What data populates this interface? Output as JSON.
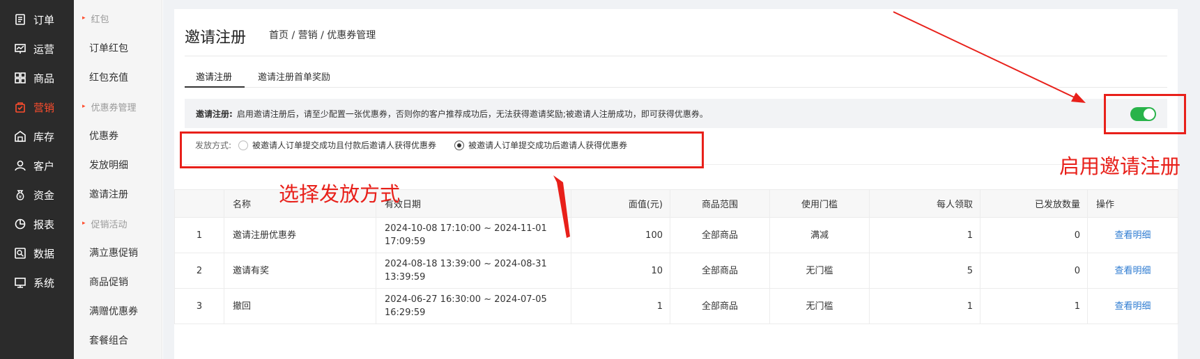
{
  "nav": [
    {
      "label": "订单",
      "icon": "order-icon"
    },
    {
      "label": "运营",
      "icon": "operation-icon"
    },
    {
      "label": "商品",
      "icon": "goods-icon"
    },
    {
      "label": "营销",
      "icon": "marketing-icon",
      "active": true
    },
    {
      "label": "库存",
      "icon": "warehouse-icon"
    },
    {
      "label": "客户",
      "icon": "user-icon"
    },
    {
      "label": "资金",
      "icon": "money-icon"
    },
    {
      "label": "报表",
      "icon": "report-icon"
    },
    {
      "label": "数据",
      "icon": "data-icon"
    },
    {
      "label": "系统",
      "icon": "monitor-icon"
    }
  ],
  "subnav": [
    {
      "label": "红包",
      "group": true
    },
    {
      "label": "订单红包"
    },
    {
      "label": "红包充值"
    },
    {
      "label": "优惠券管理",
      "group": true
    },
    {
      "label": "优惠券"
    },
    {
      "label": "发放明细"
    },
    {
      "label": "邀请注册"
    },
    {
      "label": "促销活动",
      "group": true
    },
    {
      "label": "满立惠促销"
    },
    {
      "label": "商品促销"
    },
    {
      "label": "满赠优惠券"
    },
    {
      "label": "套餐组合"
    }
  ],
  "page": {
    "title": "邀请注册",
    "breadcrumb": "首页 / 营销 / 优惠券管理"
  },
  "tabs": [
    "邀请注册",
    "邀请注册首单奖励"
  ],
  "notice": {
    "label": "邀请注册:",
    "text": "启用邀请注册后，请至少配置一张优惠券，否则你的客户推荐成功后，无法获得邀请奖励;被邀请人注册成功，即可获得优惠券。"
  },
  "toggle": {
    "on": true,
    "color": "#29b34a"
  },
  "method": {
    "label": "发放方式:",
    "options": [
      {
        "label": "被邀请人订单提交成功且付款后邀请人获得优惠券",
        "checked": false
      },
      {
        "label": "被邀请人订单提交成功后邀请人获得优惠券",
        "checked": true
      }
    ]
  },
  "table": {
    "headers": [
      "",
      "名称",
      "有效日期",
      "面值(元)",
      "商品范围",
      "使用门槛",
      "每人领取",
      "已发放数量",
      "操作"
    ],
    "rows": [
      {
        "idx": "1",
        "name": "邀请注册优惠券",
        "date1": "2024-10-08 17:10:00 ~ 2024-11-01",
        "date2": "17:09:59",
        "value": "100",
        "scope": "全部商品",
        "threshold": "满减",
        "per_person": "1",
        "issued": "0",
        "action": "查看明细"
      },
      {
        "idx": "2",
        "name": "邀请有奖",
        "date1": "2024-08-18 13:39:00 ~ 2024-08-31",
        "date2": "13:39:59",
        "value": "10",
        "scope": "全部商品",
        "threshold": "无门槛",
        "per_person": "5",
        "issued": "0",
        "action": "查看明细"
      },
      {
        "idx": "3",
        "name": "撤回",
        "date1": "2024-06-27 16:30:00 ~ 2024-07-05",
        "date2": "16:29:59",
        "value": "1",
        "scope": "全部商品",
        "threshold": "无门槛",
        "per_person": "1",
        "issued": "1",
        "action": "查看明细"
      }
    ]
  },
  "annotations": {
    "select_method": "选择发放方式",
    "enable": "启用邀请注册",
    "color": "#e8201a"
  }
}
